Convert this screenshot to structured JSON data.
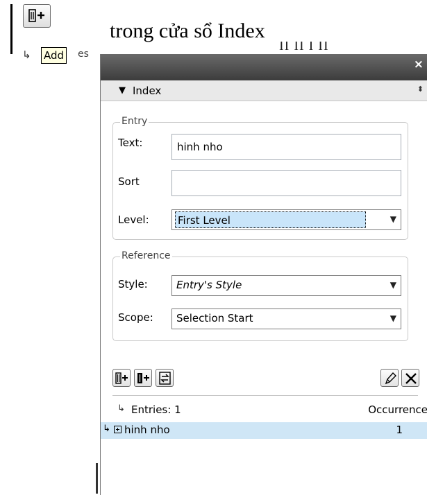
{
  "slide": {
    "heading": "trong cửa sổ Index",
    "tooltip": "Add",
    "tooltip_cut": "es",
    "hidden_text": "II II I II"
  },
  "panel": {
    "close_glyph": "×",
    "title": "Index",
    "entry": {
      "legend": "Entry",
      "text_label": "Text:",
      "text_value": "hinh nho",
      "sort_label": "Sort",
      "sort_value": "",
      "level_label": "Level:",
      "level_value": "First Level"
    },
    "reference": {
      "legend": "Reference",
      "style_label": "Style:",
      "style_value": "Entry's Style",
      "scope_label": "Scope:",
      "scope_value": "Selection Start"
    },
    "entries": {
      "label": "Entries: 1",
      "occurrence_header": "Occurrence",
      "rows": [
        {
          "topic": "hinh nho",
          "count": "1"
        }
      ]
    }
  },
  "icons": {
    "add_entry": "add-entry-icon",
    "add_all": "add-all-occurrences-icon",
    "update": "update-entry-icon",
    "edit": "pencil-icon",
    "delete": "delete-icon",
    "close": "close-icon"
  }
}
